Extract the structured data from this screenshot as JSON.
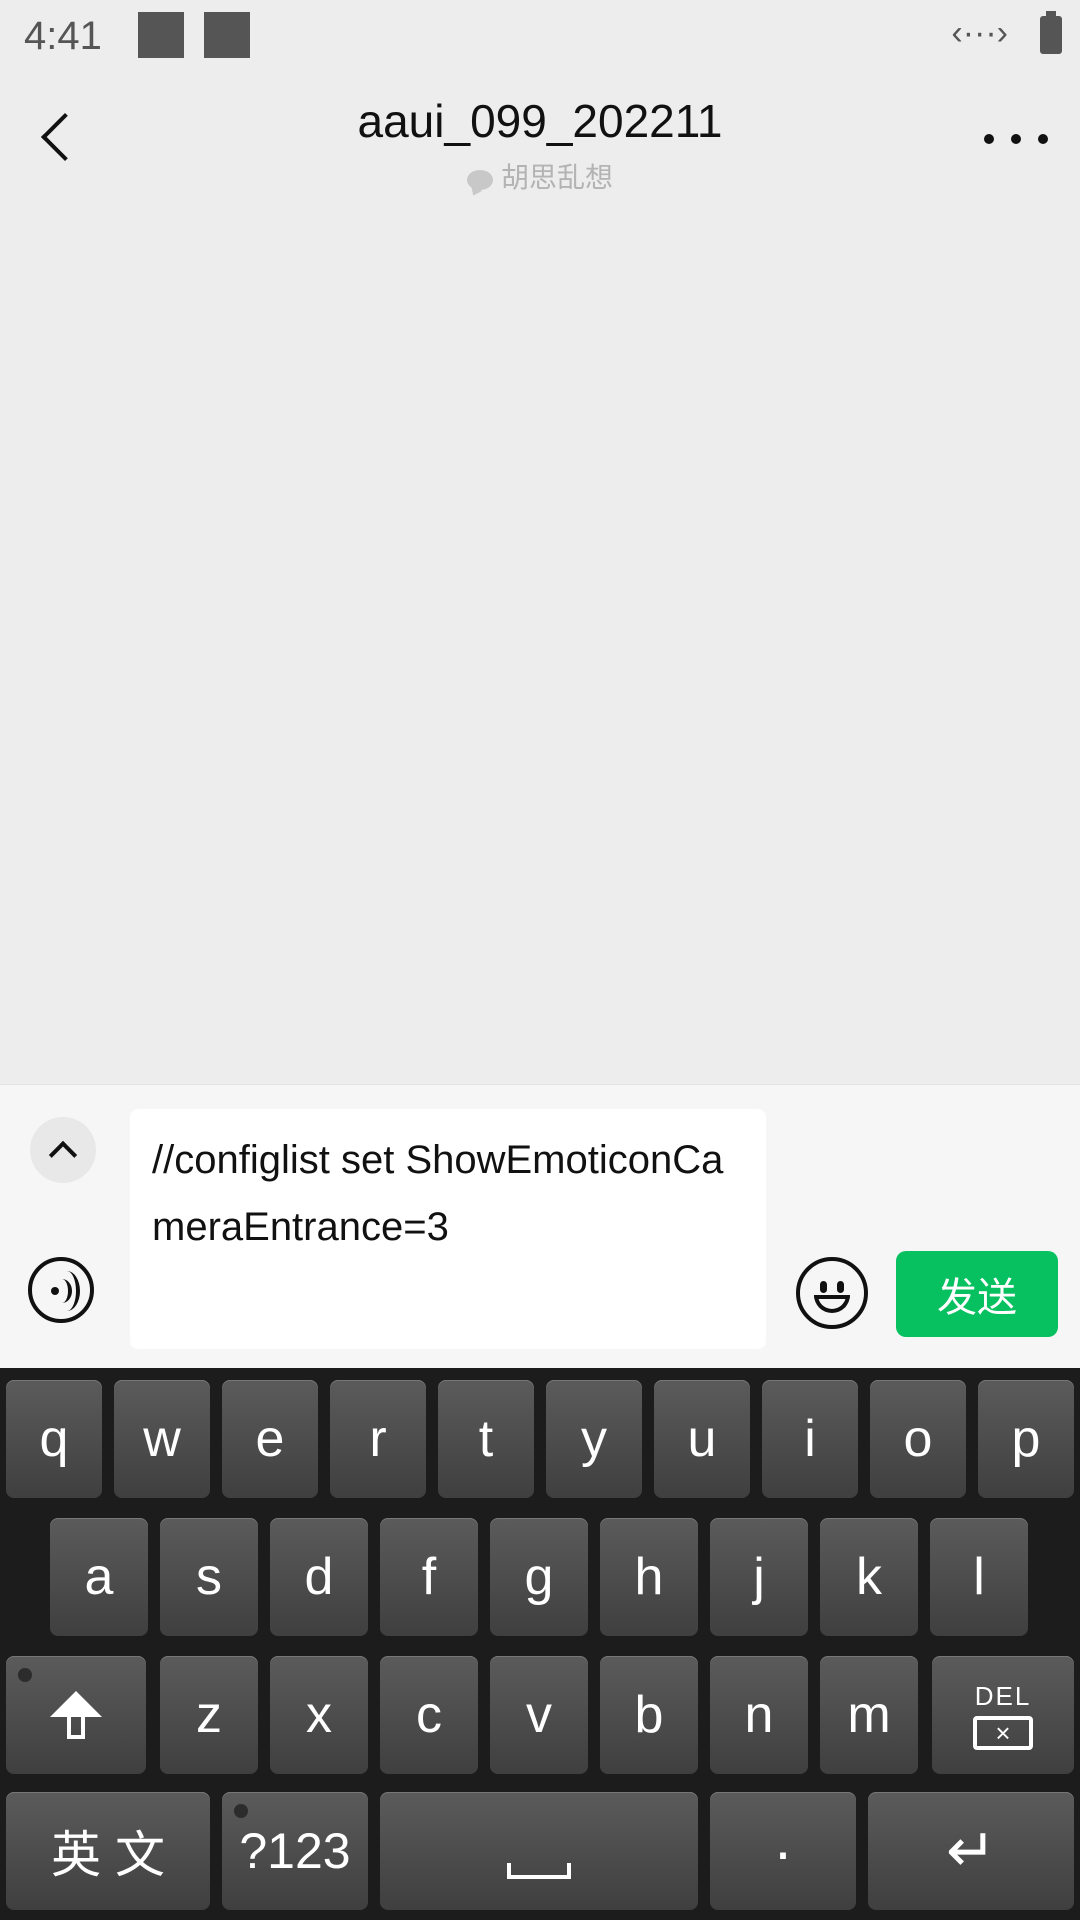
{
  "status": {
    "time": "4:41",
    "network_glyph": "‹···›"
  },
  "header": {
    "title": "aaui_099_202211",
    "subtitle": "胡思乱想"
  },
  "input": {
    "text": "//configlist set ShowEmoticonCameraEntrance=3",
    "send_label": "发送"
  },
  "keyboard": {
    "row1": [
      "q",
      "w",
      "e",
      "r",
      "t",
      "y",
      "u",
      "i",
      "o",
      "p"
    ],
    "row2": [
      "a",
      "s",
      "d",
      "f",
      "g",
      "h",
      "j",
      "k",
      "l"
    ],
    "row3": [
      "z",
      "x",
      "c",
      "v",
      "b",
      "n",
      "m"
    ],
    "del_label": "DEL",
    "lang_label": "英 文",
    "sym_label": "?123",
    "period_label": "·",
    "enter_glyph": "↵"
  },
  "colors": {
    "accent": "#07c160",
    "background": "#ededed"
  }
}
